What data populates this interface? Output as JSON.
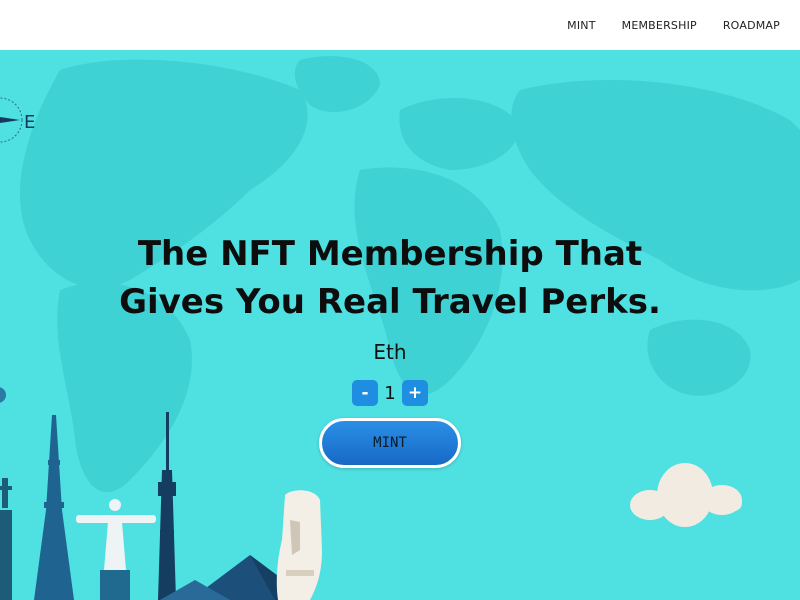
{
  "nav": {
    "items": [
      {
        "label": "MINT"
      },
      {
        "label": "MEMBERSHIP"
      },
      {
        "label": "ROADMAP"
      }
    ]
  },
  "hero": {
    "headline_line1": "The NFT Membership That",
    "headline_line2": "Gives You Real Travel Perks.",
    "currency": "Eth",
    "quantity": "1",
    "decrement_label": "-",
    "increment_label": "+",
    "mint_label": "MINT",
    "compass_letter": "E"
  },
  "colors": {
    "sky": "#4fe0e2",
    "continents": "#3ed2d4",
    "button_blue": "#1f8ee0"
  }
}
